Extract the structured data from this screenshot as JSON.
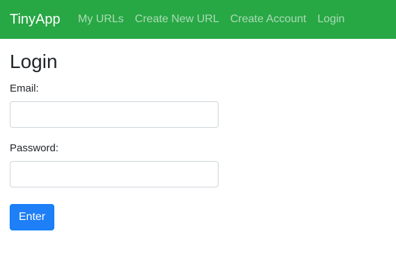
{
  "navbar": {
    "brand": "TinyApp",
    "links": [
      {
        "label": "My URLs"
      },
      {
        "label": "Create New URL"
      },
      {
        "label": "Create Account"
      },
      {
        "label": "Login"
      }
    ]
  },
  "form": {
    "title": "Login",
    "email_label": "Email:",
    "email_value": "",
    "email_placeholder": "",
    "password_label": "Password:",
    "password_value": "",
    "password_placeholder": "",
    "submit_label": "Enter"
  },
  "colors": {
    "navbar_bg": "#28a745",
    "button_bg": "#1e7ff6"
  }
}
